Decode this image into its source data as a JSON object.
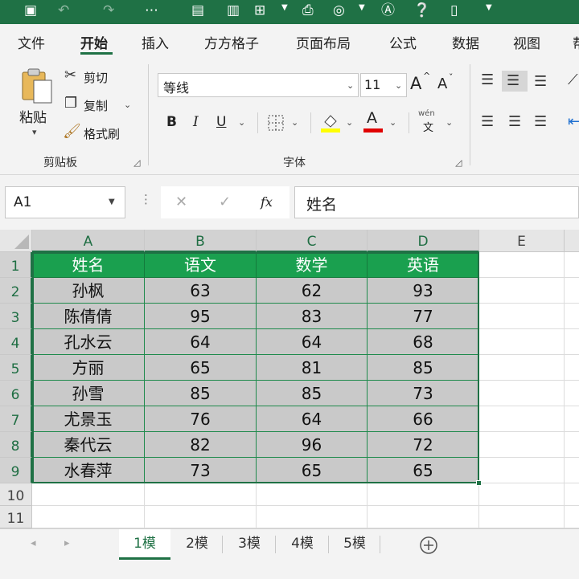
{
  "ribbon_tabs": [
    "文件",
    "开始",
    "插入",
    "方方格子",
    "页面布局",
    "公式",
    "数据",
    "视图",
    "帮"
  ],
  "active_tab": "开始",
  "clipboard": {
    "paste_label": "粘贴",
    "cut_label": "剪切",
    "copy_label": "复制",
    "format_painter_label": "格式刷",
    "group_label": "剪贴板"
  },
  "font": {
    "name": "等线",
    "size": "11",
    "group_label": "字体",
    "bold": "B",
    "italic": "I",
    "underline": "U",
    "grow": "A",
    "shrink": "A",
    "color_glyph": "A",
    "phonetic_top": "wén",
    "phonetic_bottom": "文"
  },
  "formula_bar": {
    "name_box": "A1",
    "fx": "fx",
    "content": "姓名"
  },
  "columns": [
    "A",
    "B",
    "C",
    "D",
    "E"
  ],
  "rows": [
    "1",
    "2",
    "3",
    "4",
    "5",
    "6",
    "7",
    "8",
    "9",
    "10",
    "11"
  ],
  "table": {
    "headers": [
      "姓名",
      "语文",
      "数学",
      "英语"
    ],
    "rows": [
      [
        "孙枫",
        "63",
        "62",
        "93"
      ],
      [
        "陈倩倩",
        "95",
        "83",
        "77"
      ],
      [
        "孔水云",
        "64",
        "64",
        "68"
      ],
      [
        "方丽",
        "65",
        "81",
        "85"
      ],
      [
        "孙雪",
        "85",
        "85",
        "73"
      ],
      [
        "尤景玉",
        "76",
        "64",
        "66"
      ],
      [
        "秦代云",
        "82",
        "96",
        "72"
      ],
      [
        "水春萍",
        "73",
        "65",
        "65"
      ]
    ]
  },
  "sheets": [
    "1模",
    "2模",
    "3模",
    "4模",
    "5模"
  ],
  "active_sheet": "1模",
  "colors": {
    "brand": "#1f7145",
    "header_fill": "#1aa04f",
    "data_fill": "#c9c9c9",
    "highlight": "#ffff00",
    "font_color": "#e00000"
  }
}
